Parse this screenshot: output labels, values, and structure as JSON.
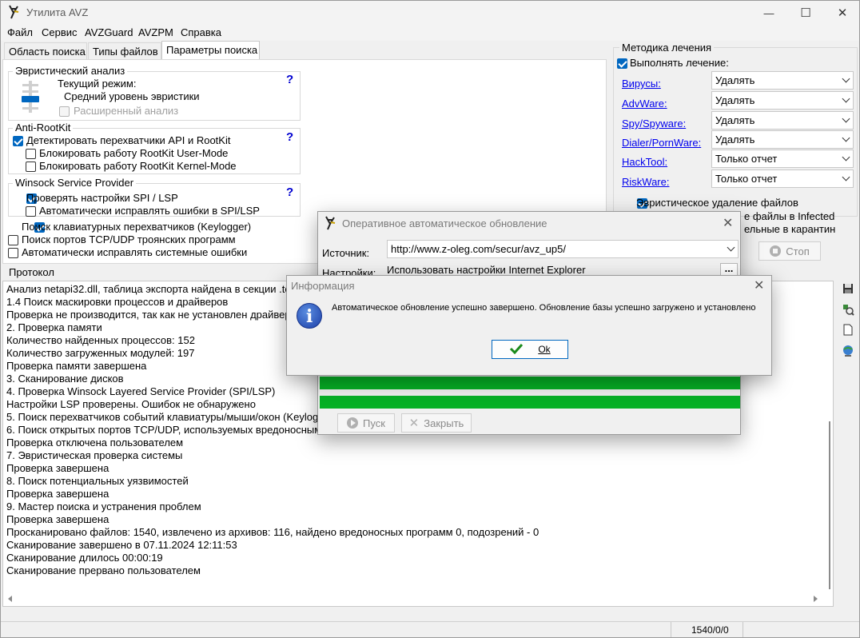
{
  "window": {
    "title": "Утилита AVZ",
    "minimize_glyph": "—",
    "maximize_glyph": "☐",
    "close_glyph": "✕"
  },
  "menu": [
    "Файл",
    "Сервис",
    "AVZGuard",
    "AVZPM",
    "Справка"
  ],
  "tabs": [
    "Область поиска",
    "Типы файлов",
    "Параметры поиска"
  ],
  "heuristic": {
    "legend": "Эвристический анализ",
    "mode_label": "Текущий режим:",
    "mode_value": "Средний уровень эвристики",
    "extended": "Расширенный анализ",
    "help": "?"
  },
  "antirootkit": {
    "legend": "Anti-RootKit",
    "detect": "Детектировать перехватчики API и RootKit",
    "block_user": "Блокировать работу RootKit User-Mode",
    "block_kernel": "Блокировать работу RootKit Kernel-Mode",
    "help": "?"
  },
  "winsock": {
    "legend": "Winsock  Service Provider",
    "check": "Проверять настройки SPI / LSP",
    "autofix": "Автоматически исправлять ошибки в SPI/LSP",
    "help": "?"
  },
  "options": {
    "keylogger": "Поиск клавиатурных перехватчиков (Keylogger)",
    "ports": "Поиск портов TCP/UDP троянских программ",
    "autofix_sys": "Автоматически исправлять системные ошибки"
  },
  "treatment": {
    "legend": "Методика лечения",
    "perform": "Выполнять лечение:",
    "rows": [
      {
        "label": "Вирусы:",
        "value": "Удалять"
      },
      {
        "label": "AdvWare:",
        "value": "Удалять"
      },
      {
        "label": "Spy/Spyware:",
        "value": "Удалять"
      },
      {
        "label": "Dialer/PornWare:",
        "value": "Удалять"
      },
      {
        "label": "HackTool:",
        "value": "Только отчет"
      },
      {
        "label": "RiskWare:",
        "value": "Только отчет"
      }
    ],
    "heuristic_delete": "Эвристическое удаление файлов",
    "infected_partial": "е файлы в  Infected",
    "quarantine_partial": "ельные в  карантин",
    "stop": "Стоп"
  },
  "log": {
    "legend": "Протокол",
    "lines": [
      "Анализ netapi32.dll, таблица экспорта найдена в секции .te",
      "1.4 Поиск маскировки процессов и драйверов",
      " Проверка не производится, так как не установлен драйвер",
      "2. Проверка памяти",
      " Количество найденных процессов: 152",
      " Количество загруженных модулей: 197",
      "Проверка памяти завершена",
      "3. Сканирование дисков",
      "4. Проверка Winsock Layered Service Provider (SPI/LSP)",
      " Настройки LSP проверены. Ошибок не обнаружено",
      "5. Поиск перехватчиков событий клавиатуры/мыши/окон (Keylogg",
      "6. Поиск открытых портов TCP/UDP, используемых вредоносным",
      " Проверка отключена пользователем",
      "7. Эвристическая проверка системы",
      "Проверка завершена",
      "8. Поиск потенциальных уязвимостей",
      "Проверка завершена",
      "9. Мастер поиска и устранения проблем",
      "Проверка завершена",
      "Просканировано файлов: 1540, извлечено из архивов: 116, найдено вредоносных программ 0, подозрений - 0",
      "Сканирование завершено в 07.11.2024 12:11:53",
      "Сканирование длилось 00:00:19",
      "Сканирование прервано пользователем"
    ]
  },
  "status": {
    "counter": "1540/0/0"
  },
  "update_dialog": {
    "title": "Оперативное автоматическое обновление",
    "source_label": "Источник:",
    "source_value": "http://www.z-oleg.com/secur/avz_up5/",
    "settings_label": "Настройки:",
    "settings_value": "Использовать настройки Internet Explorer",
    "more": "...",
    "start": "Пуск",
    "close": "Закрыть",
    "progress_1": 1.0,
    "progress_2": 1.0,
    "progress_color": "#06b025"
  },
  "info_dialog": {
    "title": "Информация",
    "message": "Автоматическое обновление успешно завершено. Обновление базы успешно загружено и установлено",
    "ok": "Ok"
  },
  "colors": {
    "accent": "#0067c0",
    "link": "#0000ee",
    "help": "#0000d0"
  }
}
